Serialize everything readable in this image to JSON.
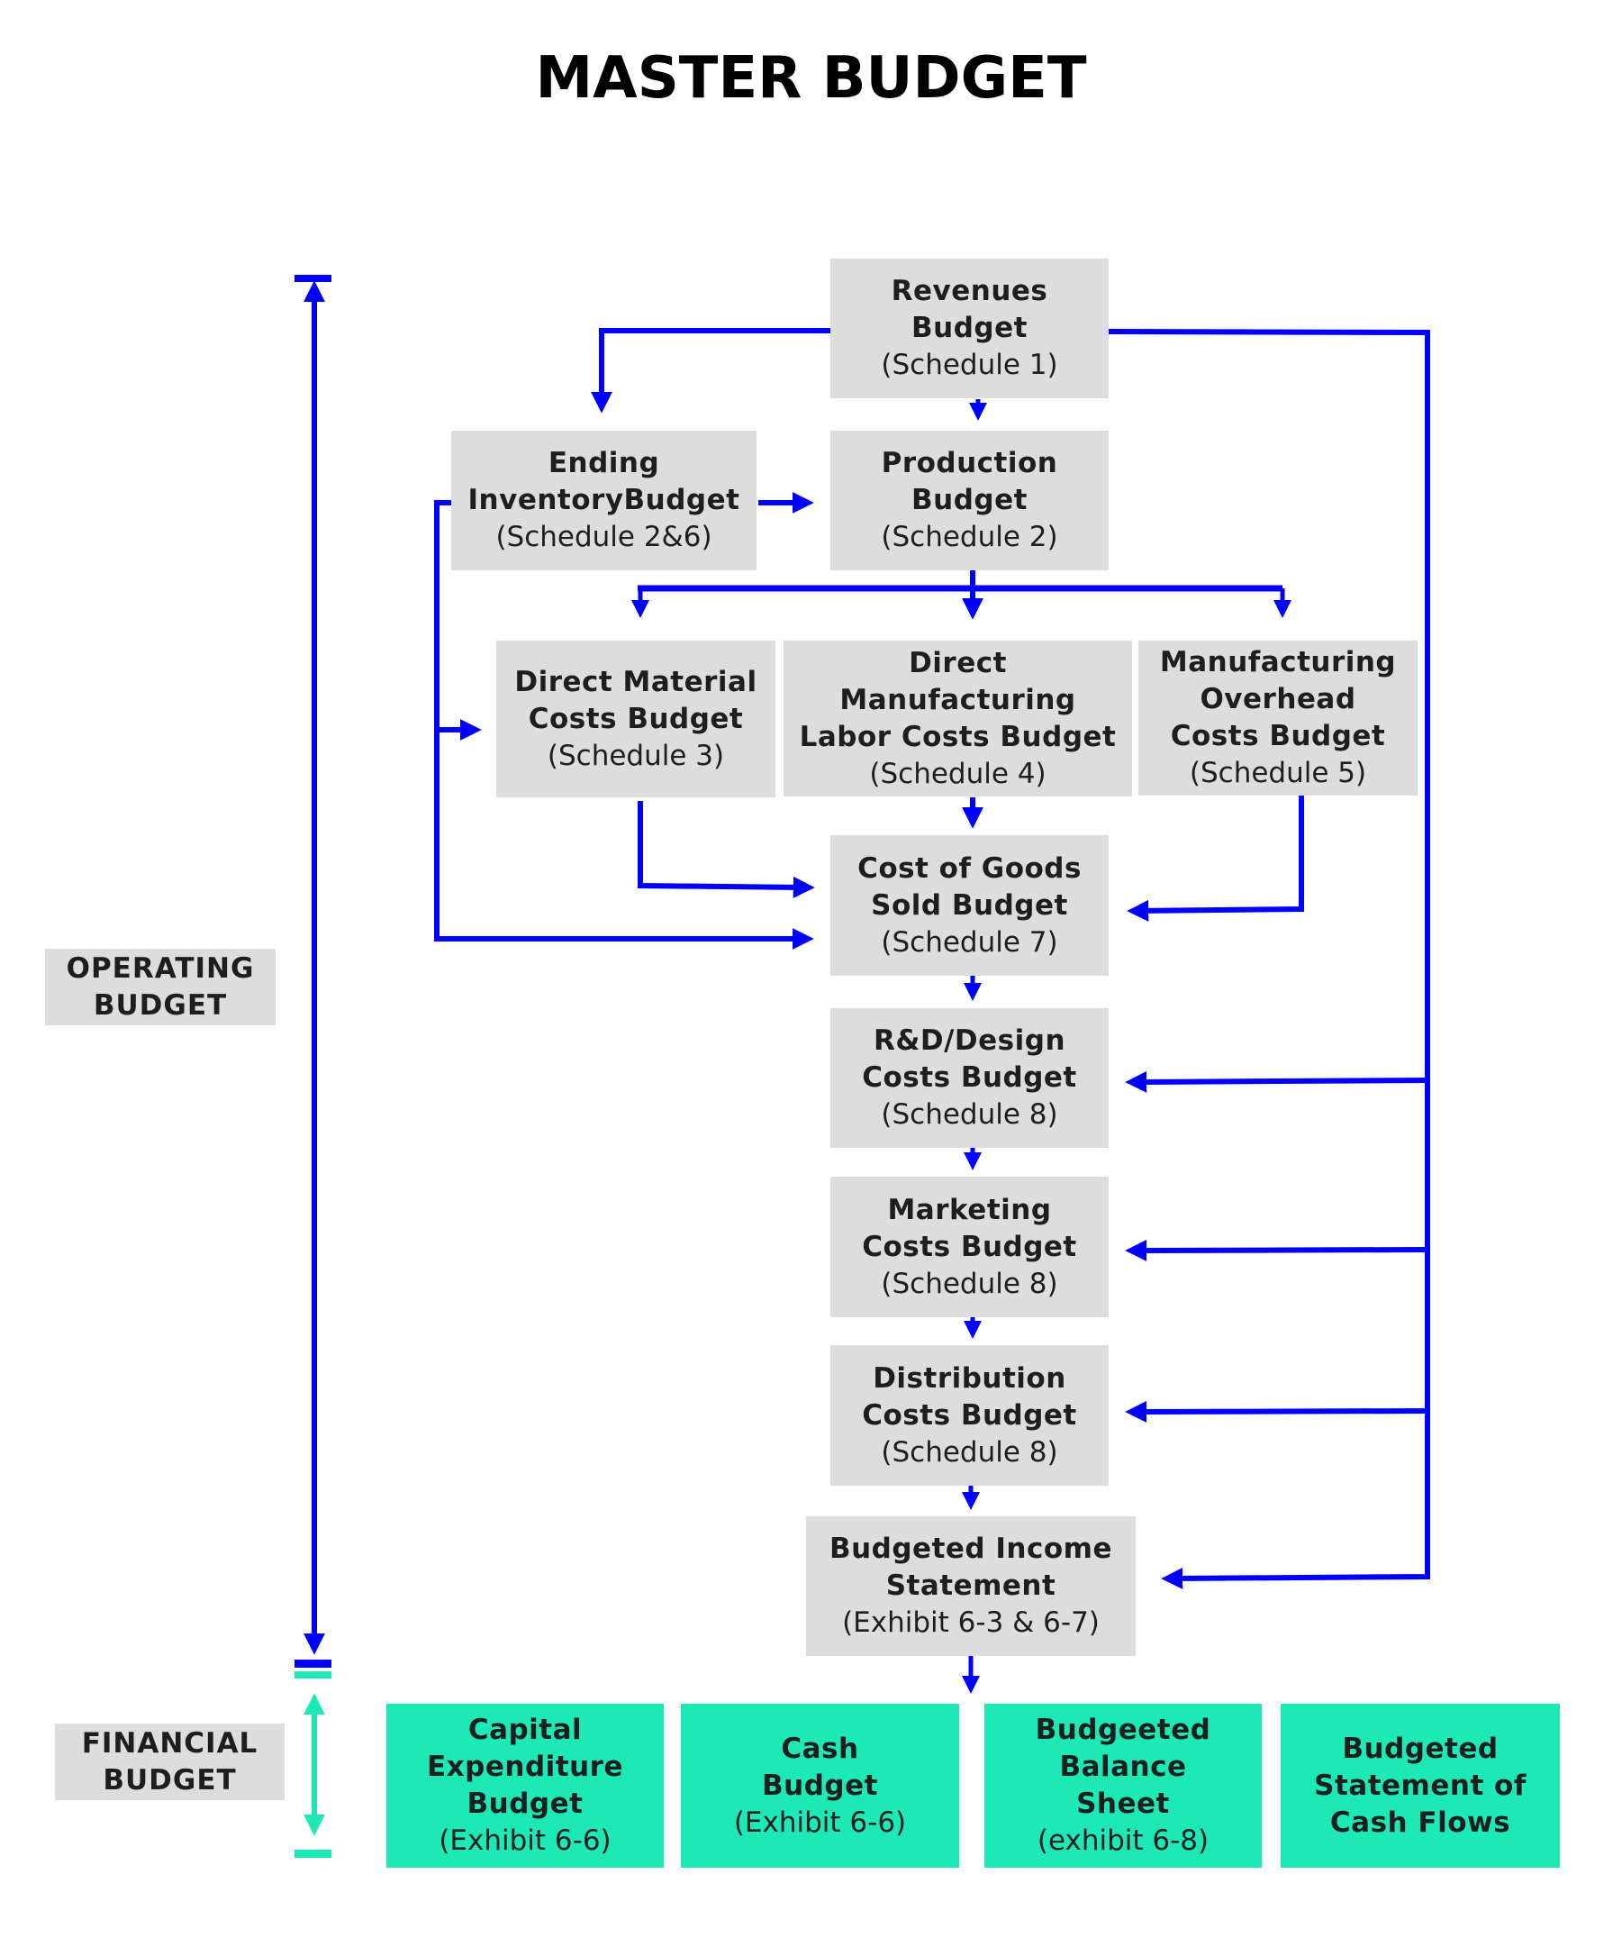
{
  "title": "MASTER BUDGET",
  "colors": {
    "operating_flow": "#0000ff",
    "financial_flow": "#1de9b6",
    "box_gray": "#dddddd",
    "box_teal": "#1de9b6",
    "text": "#1e1e1e"
  },
  "sections": {
    "operating": {
      "line1": "OPERATING",
      "line2": "BUDGET"
    },
    "financial": {
      "line1": "FINANCIAL",
      "line2": "BUDGET"
    }
  },
  "operating_boxes": {
    "revenues": {
      "lines": [
        "Revenues",
        "Budget"
      ],
      "ref": "(Schedule 1)"
    },
    "ending_inventory": {
      "lines": [
        "Ending",
        "InventoryBudget"
      ],
      "ref": "(Schedule 2&6)"
    },
    "production": {
      "lines": [
        "Production",
        "Budget"
      ],
      "ref": "(Schedule 2)"
    },
    "direct_material": {
      "lines": [
        "Direct Material",
        "Costs Budget"
      ],
      "ref": "(Schedule 3)"
    },
    "direct_labor": {
      "lines": [
        "Direct",
        "Manufacturing",
        "Labor Costs Budget"
      ],
      "ref": "(Schedule 4)"
    },
    "overhead": {
      "lines": [
        "Manufacturing",
        "Overhead",
        "Costs Budget"
      ],
      "ref": "(Schedule 5)"
    },
    "cogs": {
      "lines": [
        "Cost of Goods",
        "Sold Budget"
      ],
      "ref": "(Schedule 7)"
    },
    "rnd": {
      "lines": [
        "R&D/Design",
        "Costs Budget"
      ],
      "ref": "(Schedule 8)"
    },
    "marketing": {
      "lines": [
        "Marketing",
        "Costs Budget"
      ],
      "ref": "(Schedule 8)"
    },
    "distribution": {
      "lines": [
        "Distribution",
        "Costs Budget"
      ],
      "ref": "(Schedule 8)"
    },
    "income_statement": {
      "lines": [
        "Budgeted Income",
        "Statement"
      ],
      "ref": "(Exhibit 6-3 & 6-7)"
    }
  },
  "financial_boxes": {
    "capex": {
      "lines": [
        "Capital",
        "Expenditure",
        "Budget"
      ],
      "ref": "(Exhibit 6-6)"
    },
    "cash": {
      "lines": [
        "Cash",
        "Budget"
      ],
      "ref": "(Exhibit 6-6)"
    },
    "balance_sheet": {
      "lines": [
        "Budgeeted",
        "Balance",
        "Sheet"
      ],
      "ref": "(exhibit 6-8)"
    },
    "cash_flows": {
      "lines": [
        "Budgeted",
        "Statement of",
        "Cash Flows"
      ],
      "ref": ""
    }
  }
}
